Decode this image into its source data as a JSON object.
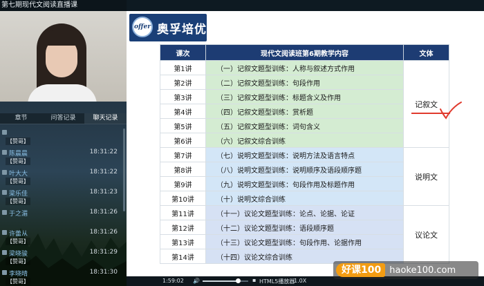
{
  "window": {
    "title": "第七期现代文阅读直播课"
  },
  "panel": {
    "tabs": [
      {
        "label": "章节"
      },
      {
        "label": "问答记录"
      },
      {
        "label": "聊天记录"
      }
    ],
    "chat": [
      {
        "name": "",
        "time": "",
        "msg": "【赞哥】"
      },
      {
        "name": "陈晨晨",
        "time": "18:31:22",
        "msg": "【赞哥】"
      },
      {
        "name": "叶大大",
        "time": "18:31:22",
        "msg": "【赞哥】"
      },
      {
        "name": "梁乐佳",
        "time": "18:31:23",
        "msg": "【赞哥】"
      },
      {
        "name": "于之湄",
        "time": "18:31:26",
        "msg": ""
      },
      {
        "name": "许蕾从",
        "time": "18:31:26",
        "msg": "【赞哥】"
      },
      {
        "name": "梁晓骏",
        "time": "18:31:29",
        "msg": "【赞哥】"
      },
      {
        "name": "李晓晴",
        "time": "18:31:30",
        "msg": "【赞哥】"
      }
    ]
  },
  "slide": {
    "brand": "奥孚培优",
    "logo_text": "offer",
    "table": {
      "headers": {
        "lecture": "课次",
        "content": "现代文阅读班第6期教学内容",
        "style": "文体"
      },
      "rows": [
        {
          "lecture": "第1讲",
          "content": "（一）记叙文题型训练：人称与叙述方式作用"
        },
        {
          "lecture": "第2讲",
          "content": "（二）记叙文题型训练：句段作用"
        },
        {
          "lecture": "第3讲",
          "content": "（三）记叙文题型训练：标题含义及作用"
        },
        {
          "lecture": "第4讲",
          "content": "（四）记叙文题型训练：赏析题"
        },
        {
          "lecture": "第5讲",
          "content": "（五）记叙文题型训练：词句含义"
        },
        {
          "lecture": "第6讲",
          "content": "（六）记叙文综合训练"
        },
        {
          "lecture": "第7讲",
          "content": "（七）说明文题型训练：说明方法及语言特点"
        },
        {
          "lecture": "第8讲",
          "content": "（八）说明文题型训练：说明顺序及语段顺序题"
        },
        {
          "lecture": "第9讲",
          "content": "（九）说明文题型训练：句段作用及标题作用"
        },
        {
          "lecture": "第10讲",
          "content": "（十）说明文综合训练"
        },
        {
          "lecture": "第11讲",
          "content": "（十一）议论文题型训练：论点、论据、论证"
        },
        {
          "lecture": "第12讲",
          "content": "（十二）议论文题型训练：语段顺序题"
        },
        {
          "lecture": "第13讲",
          "content": "（十三）议论文题型训练：句段作用、论据作用"
        },
        {
          "lecture": "第14讲",
          "content": "（十四）议论文综合训练"
        }
      ],
      "styles": [
        "记叙文",
        "说明文",
        "议论文"
      ]
    }
  },
  "player": {
    "time": "1:59:02",
    "volume": 0.78,
    "player_name": "HTML5播放器",
    "speed": "1.0X"
  },
  "watermark": {
    "badge": "好课100",
    "url": "haoke100.com"
  },
  "colors": {
    "header": "#1d3c73",
    "narrative_row": "#d4ecd2",
    "expository_row": "#d3e6f7",
    "argumentative_row": "#d6e1f4",
    "annotation": "#e03a2d"
  }
}
